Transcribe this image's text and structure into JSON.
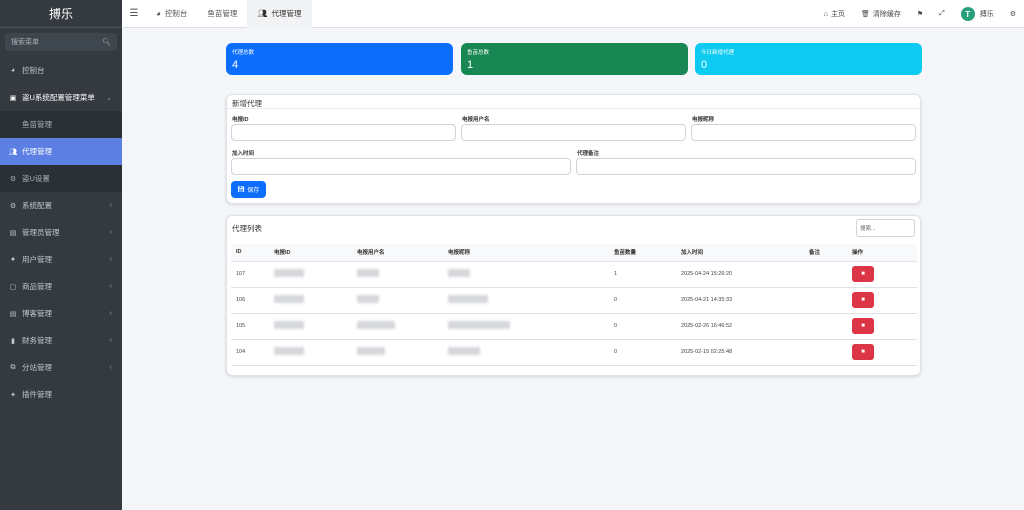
{
  "brand": "搏乐",
  "sidebar": {
    "search_placeholder": "搜索菜单",
    "items": [
      {
        "label": "控制台",
        "icon": "dashboard-icon"
      },
      {
        "label": "盗U系统配置管理菜单",
        "icon": "monitor-icon"
      },
      {
        "label": "鱼苗管理",
        "icon": ""
      },
      {
        "label": "代理管理",
        "icon": "users-icon"
      },
      {
        "label": "盗U设置",
        "icon": "gear-icon"
      },
      {
        "label": "系统配置",
        "icon": "gears-icon"
      },
      {
        "label": "管理员管理",
        "icon": "id-card-icon"
      },
      {
        "label": "用户管理",
        "icon": "user-icon"
      },
      {
        "label": "商品管理",
        "icon": "box-icon"
      },
      {
        "label": "博客管理",
        "icon": "book-icon"
      },
      {
        "label": "财务管理",
        "icon": "bookmark-icon"
      },
      {
        "label": "分站管理",
        "icon": "sitemap-icon"
      },
      {
        "label": "插件管理",
        "icon": "plug-icon"
      }
    ]
  },
  "topbar": {
    "tabs": [
      {
        "label": "控制台",
        "icon": "dashboard-icon"
      },
      {
        "label": "鱼苗管理",
        "icon": ""
      },
      {
        "label": "代理管理",
        "icon": "users-icon"
      }
    ],
    "home_label": "主页",
    "clear_cache_label": "清除缓存",
    "user_name": "搏乐"
  },
  "stats": [
    {
      "label": "代理总数",
      "value": "4",
      "color": "#0d6efd"
    },
    {
      "label": "鱼苗总数",
      "value": "1",
      "color": "#198754"
    },
    {
      "label": "今日新增代理",
      "value": "0",
      "color": "#0dcaf0"
    }
  ],
  "add_form": {
    "title": "新增代理",
    "fields": {
      "tg_id": "电报ID",
      "tg_username": "电报用户名",
      "tg_nickname": "电报昵称",
      "join_time": "加入时间",
      "remark": "代理备注"
    },
    "save_label": "保存"
  },
  "list": {
    "title": "代理列表",
    "search_placeholder": "搜索...",
    "columns": [
      "ID",
      "电报ID",
      "电报用户名",
      "电报昵称",
      "鱼苗数量",
      "加入时间",
      "备注",
      "操作"
    ],
    "rows": [
      {
        "id": "107",
        "fish_count": "1",
        "join_time": "2025-04-24 15:26:20",
        "remark": ""
      },
      {
        "id": "106",
        "fish_count": "0",
        "join_time": "2025-04-21 14:35:33",
        "remark": ""
      },
      {
        "id": "105",
        "fish_count": "0",
        "join_time": "2025-02-26 16:46:52",
        "remark": ""
      },
      {
        "id": "104",
        "fish_count": "0",
        "join_time": "2025-02-15 02:25:48",
        "remark": ""
      }
    ]
  }
}
